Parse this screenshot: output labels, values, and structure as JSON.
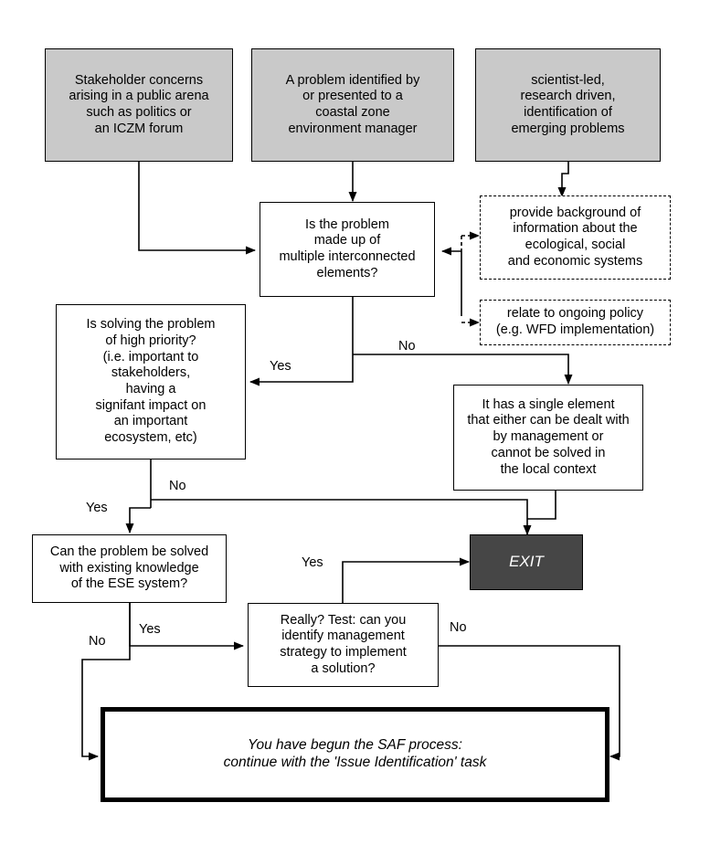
{
  "diagram": {
    "title": "SAF process issue-identification flowchart",
    "colors": {
      "source_box_fill": "#c9c9c9",
      "exit_box_fill": "#464646",
      "exit_text": "#ffffff",
      "line": "#000000",
      "background": "#ffffff"
    }
  },
  "nodes": {
    "stakeholder_concerns": {
      "label": "Stakeholder concerns\narising in a public arena\nsuch as politics or\nan ICZM forum",
      "style": "solid-grey"
    },
    "problem_identified": {
      "label": "A problem identified by\nor presented to a\ncoastal zone\nenvironment manager",
      "style": "solid-grey"
    },
    "scientist_led": {
      "label": "scientist-led,\nresearch driven,\nidentification of\nemerging problems",
      "style": "solid-grey"
    },
    "multiple_elements_question": {
      "label": "Is the problem\nmade up of\nmultiple interconnected\nelements?",
      "style": "solid-white"
    },
    "provide_background": {
      "label": "provide background of\ninformation about the\necological, social\nand economic systems",
      "style": "dashed-white"
    },
    "relate_policy": {
      "label": "relate to ongoing policy\n(e.g. WFD implementation)",
      "style": "dashed-white"
    },
    "high_priority_question": {
      "label": "Is solving the problem\nof high priority?\n(i.e. important to\nstakeholders,\nhaving a\nsignifant impact on\nan important\necosystem, etc)",
      "style": "solid-white"
    },
    "single_element": {
      "label": "It has a single element\nthat either can be dealt with\nby management or\ncannot be solved in\nthe local context",
      "style": "solid-white"
    },
    "existing_knowledge_question": {
      "label": "Can the problem be solved\nwith existing knowledge\nof the ESE system?",
      "style": "solid-white"
    },
    "really_test_question": {
      "label": "Really? Test: can you\nidentify management\nstrategy to implement\na solution?",
      "style": "solid-white"
    },
    "exit": {
      "label": "EXIT",
      "style": "dark"
    },
    "saf_begun": {
      "label": "You have begun the SAF process:\ncontinue with the 'Issue Identification' task",
      "style": "thick"
    }
  },
  "edge_labels": {
    "multiple_yes": "Yes",
    "multiple_no": "No",
    "priority_yes": "Yes",
    "priority_no": "No",
    "knowledge_yes": "Yes",
    "knowledge_no": "No",
    "really_yes": "Yes",
    "really_no": "No"
  }
}
